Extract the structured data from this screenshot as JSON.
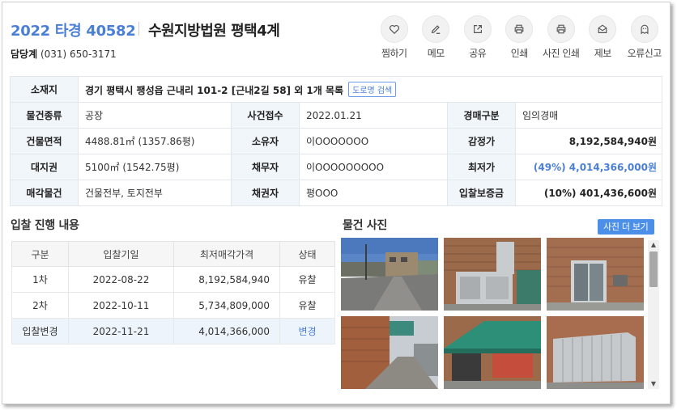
{
  "header": {
    "case_number": "2022 타경 40582",
    "court": "수원지방법원 평택4계",
    "contact_label": "담당계",
    "contact_phone": "(031) 650-3171"
  },
  "actions": [
    {
      "label": "찜하기",
      "icon": "heart-icon"
    },
    {
      "label": "메모",
      "icon": "edit-icon"
    },
    {
      "label": "공유",
      "icon": "share-icon"
    },
    {
      "label": "인쇄",
      "icon": "print-icon"
    },
    {
      "label": "사진 인쇄",
      "icon": "photo-print-icon"
    },
    {
      "label": "제보",
      "icon": "mail-icon"
    },
    {
      "label": "오류신고",
      "icon": "ghost-icon"
    }
  ],
  "info": {
    "address_label": "소재지",
    "address": "경기 평택시 팽성읍 근내리 101-2 [근내2길 58] 외 1개 목록",
    "road_search_label": "도로명 검색",
    "rows": [
      {
        "l1": "물건종류",
        "v1": "공장",
        "l2": "사건접수",
        "v2": "2022.01.21",
        "l3": "경매구분",
        "v3": "임의경매"
      },
      {
        "l1": "건물면적",
        "v1": "4488.81㎡ (1357.86평)",
        "l2": "소유자",
        "v2": "이OOOOOOO",
        "l3": "감정가",
        "v3": "8,192,584,940원"
      },
      {
        "l1": "대지권",
        "v1": "5100㎡ (1542.75평)",
        "l2": "채무자",
        "v2": "이OOOOOOOOO",
        "l3": "최저가",
        "v3": "(49%) 4,014,366,000원"
      },
      {
        "l1": "매각물건",
        "v1": "건물전부, 토지전부",
        "l2": "채권자",
        "v2": "평OOO",
        "l3": "입찰보증금",
        "v3": "(10%) 401,436,600원"
      }
    ]
  },
  "bidding": {
    "title": "입찰 진행 내용",
    "headers": [
      "구분",
      "입찰기일",
      "최저매각가격",
      "상태"
    ],
    "rows": [
      {
        "round": "1차",
        "date": "2022-08-22",
        "price": "8,192,584,940",
        "status": "유찰"
      },
      {
        "round": "2차",
        "date": "2022-10-11",
        "price": "5,734,809,000",
        "status": "유찰"
      },
      {
        "round": "입찰변경",
        "date": "2022-11-21",
        "price": "4,014,366,000",
        "status": "변경"
      }
    ]
  },
  "photos": {
    "title": "물건 사진",
    "more_label": "사진 더 보기"
  },
  "colors": {
    "accent": "#4b7fd6",
    "button_blue": "#4b8fe8",
    "header_cell_bg": "#f1f6fb"
  }
}
